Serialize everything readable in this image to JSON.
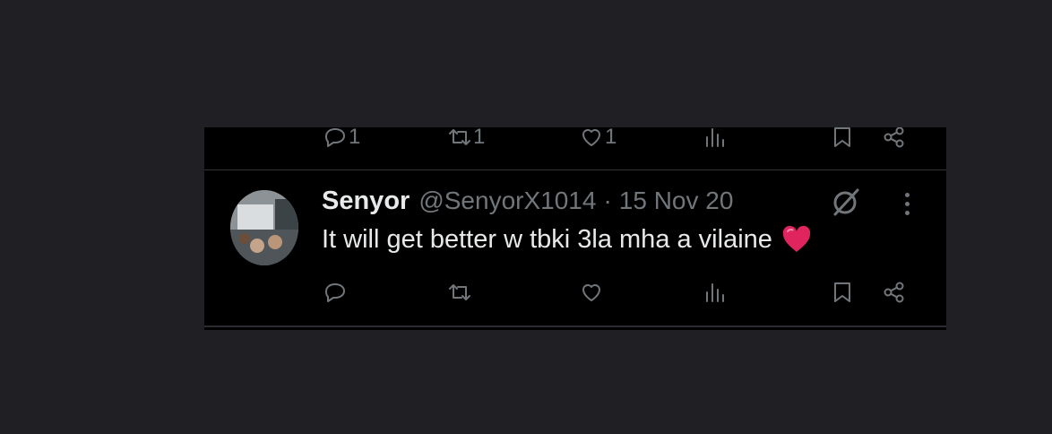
{
  "previous_tweet": {
    "actions": {
      "reply_count": "1",
      "retweet_count": "1",
      "like_count": "1"
    }
  },
  "tweet": {
    "display_name": "Senyor",
    "handle": "@SenyorX1014",
    "separator": "·",
    "date": "15 Nov 20",
    "text": "It will get better w tbki 3la mha a vilaine",
    "emoji": "heart-emoji"
  },
  "icons": {
    "reply": "reply-icon",
    "retweet": "retweet-icon",
    "like": "like-icon",
    "views": "views-icon",
    "bookmark": "bookmark-icon",
    "share": "share-icon",
    "grok": "grok-icon",
    "more": "more-icon"
  },
  "colors": {
    "background": "#202024",
    "panel": "#000000",
    "primary_text": "#e7e9ea",
    "secondary_text": "#71767b",
    "heart": "#e0245e"
  }
}
